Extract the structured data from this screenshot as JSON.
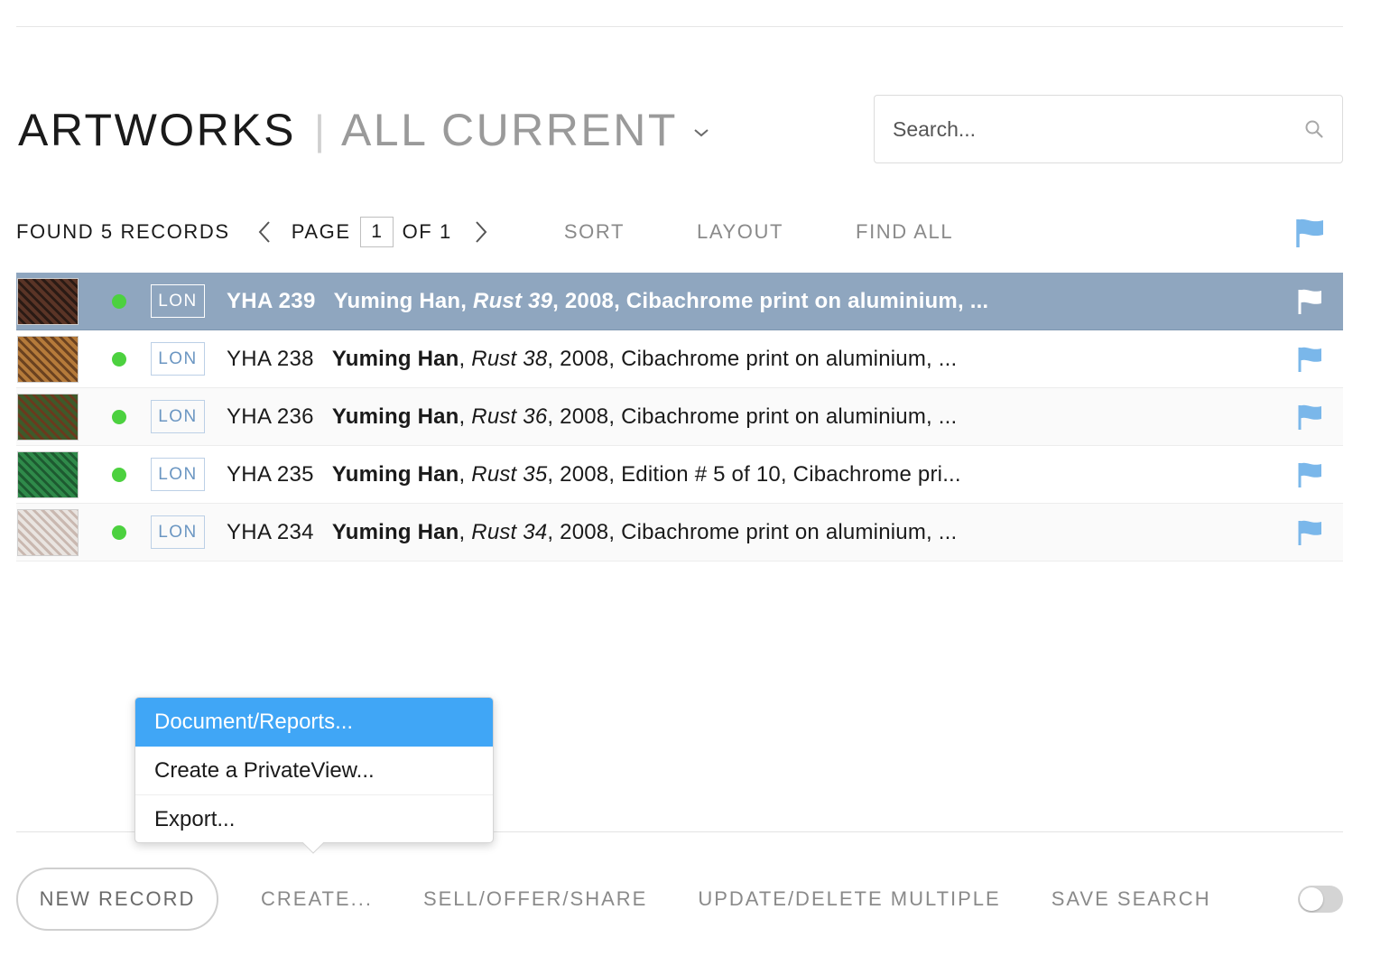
{
  "header": {
    "title": "ARTWORKS",
    "separator": "|",
    "view": "ALL CURRENT",
    "view_dropdown_icon": "chevron-down-icon"
  },
  "search": {
    "placeholder": "Search...",
    "value": "",
    "icon": "search-icon"
  },
  "toolbar": {
    "found_text": "FOUND 5 RECORDS",
    "page_label": "PAGE",
    "current_page": "1",
    "of_label": "OF 1",
    "sort_label": "SORT",
    "layout_label": "LAYOUT",
    "find_all_label": "FIND ALL",
    "flag_icon": "flag-icon"
  },
  "colors": {
    "accent_blue": "#40a6f6",
    "selected_row": "#8fa6bf",
    "status_green": "#4cd13f",
    "flag_blue": "#7ab7ea",
    "badge_blue": "#6b96c2"
  },
  "records": [
    {
      "thumb_icon": "artwork-thumbnail",
      "thumb_color_a": "#5a3426",
      "thumb_color_b": "#2a1a14",
      "location": "LON",
      "ref": "YHA 239",
      "artist": "Yuming Han",
      "work_title": "Rust 39",
      "details": ", 2008, Cibachrome print on aluminium, ...",
      "selected": true
    },
    {
      "thumb_icon": "artwork-thumbnail",
      "thumb_color_a": "#b57a3a",
      "thumb_color_b": "#6b4220",
      "location": "LON",
      "ref": "YHA 238",
      "artist": "Yuming Han",
      "work_title": "Rust 38",
      "details": ", 2008, Cibachrome print on aluminium, ...",
      "selected": false
    },
    {
      "thumb_icon": "artwork-thumbnail",
      "thumb_color_a": "#3e5a2a",
      "thumb_color_b": "#6a3a1e",
      "location": "LON",
      "ref": "YHA 236",
      "artist": "Yuming Han",
      "work_title": "Rust 36",
      "details": ", 2008, Cibachrome print on aluminium, ...",
      "selected": false
    },
    {
      "thumb_icon": "artwork-thumbnail",
      "thumb_color_a": "#2f8a4a",
      "thumb_color_b": "#1d5a30",
      "location": "LON",
      "ref": "YHA 235",
      "artist": "Yuming Han",
      "work_title": "Rust 35",
      "details": ", 2008, Edition # 5 of 10, Cibachrome pri...",
      "selected": false
    },
    {
      "thumb_icon": "artwork-thumbnail",
      "thumb_color_a": "#e9e4e0",
      "thumb_color_b": "#c9b8b0",
      "location": "LON",
      "ref": "YHA 234",
      "artist": "Yuming Han",
      "work_title": "Rust 34",
      "details": ", 2008, Cibachrome print on aluminium, ...",
      "selected": false
    }
  ],
  "create_menu": {
    "items": [
      {
        "label": "Document/Reports...",
        "active": true
      },
      {
        "label": "Create a PrivateView...",
        "active": false
      },
      {
        "label": "Export...",
        "active": false
      }
    ]
  },
  "bottom_bar": {
    "new_record_label": "NEW RECORD",
    "create_label": "CREATE...",
    "sell_label": "SELL/OFFER/SHARE",
    "update_label": "UPDATE/DELETE MULTIPLE",
    "save_search_label": "SAVE SEARCH",
    "toggle_on": false
  }
}
